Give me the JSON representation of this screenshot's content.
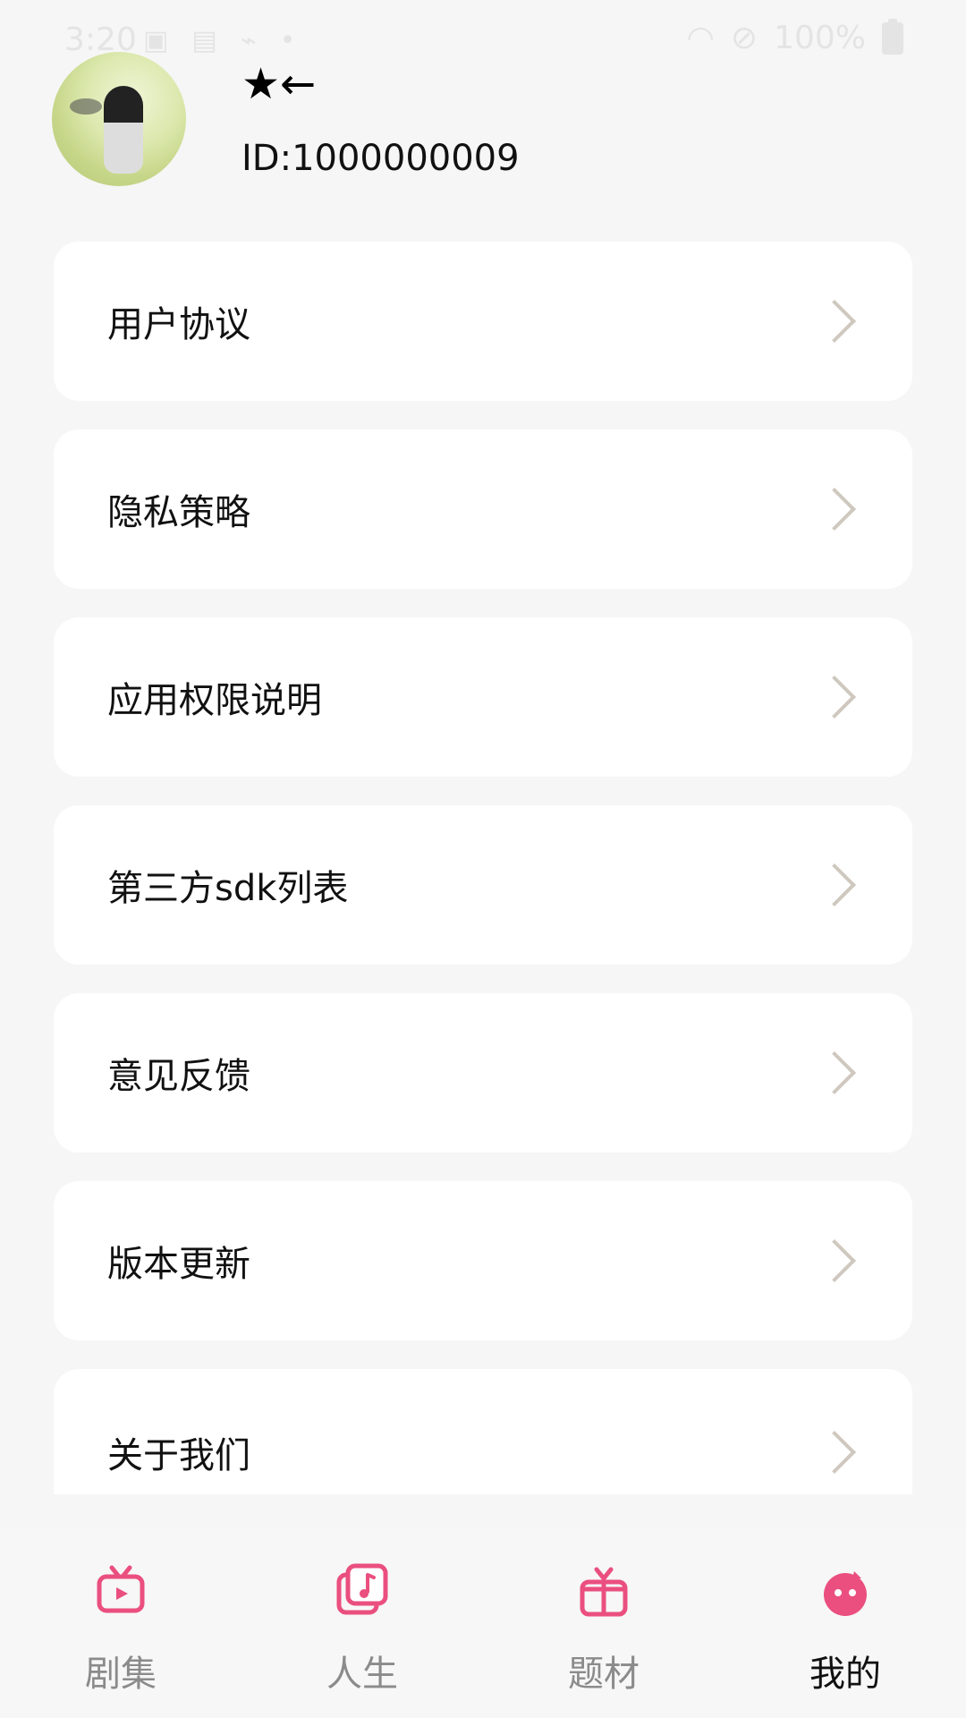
{
  "status_bar": {
    "time": "3:20",
    "battery": "100%"
  },
  "profile": {
    "name": "★←",
    "id": "ID:1000000009"
  },
  "menu": {
    "items": [
      {
        "label": "用户协议"
      },
      {
        "label": "隐私策略"
      },
      {
        "label": "应用权限说明"
      },
      {
        "label": "第三方sdk列表"
      },
      {
        "label": "意见反馈"
      },
      {
        "label": "版本更新"
      },
      {
        "label": "关于我们"
      }
    ]
  },
  "bottom_nav": {
    "items": [
      {
        "label": "剧集",
        "icon": "tv-play-icon"
      },
      {
        "label": "人生",
        "icon": "music-library-icon"
      },
      {
        "label": "题材",
        "icon": "gift-box-icon"
      },
      {
        "label": "我的",
        "icon": "mascot-face-icon"
      }
    ],
    "active_index": 3,
    "accent_color": "#ea4f7f",
    "inactive_text_color": "#8b8b8b"
  }
}
